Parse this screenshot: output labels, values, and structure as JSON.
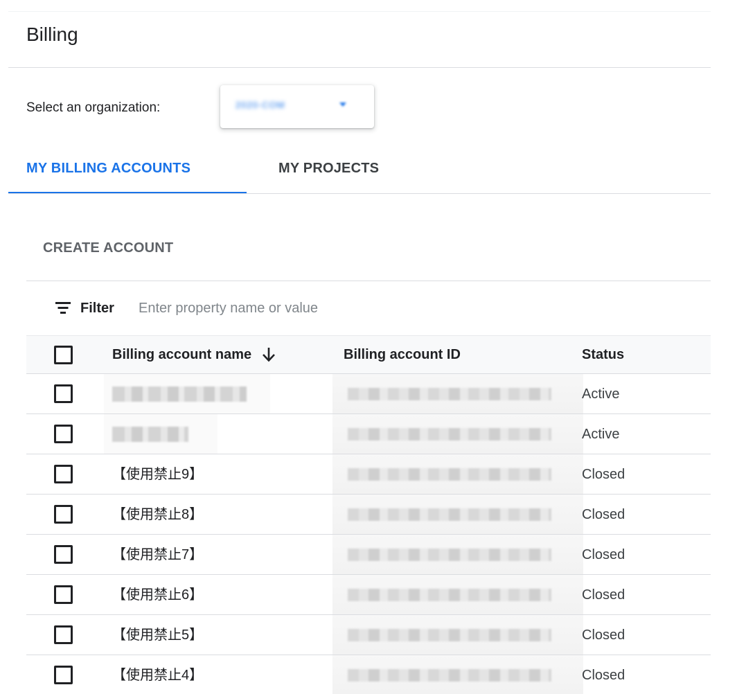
{
  "header": {
    "title": "Billing"
  },
  "organization": {
    "label": "Select an organization:",
    "selected_value": "2020-COM"
  },
  "tabs": [
    {
      "label": "MY BILLING ACCOUNTS",
      "active": true
    },
    {
      "label": "MY PROJECTS",
      "active": false
    }
  ],
  "toolbar": {
    "create_label": "CREATE ACCOUNT"
  },
  "filter": {
    "label": "Filter",
    "placeholder": "Enter property name or value"
  },
  "table": {
    "columns": {
      "name": "Billing account name",
      "id": "Billing account ID",
      "status": "Status"
    },
    "sort": {
      "column": "name",
      "direction": "descending"
    },
    "rows": [
      {
        "name": "",
        "name_redacted": true,
        "status": "Active"
      },
      {
        "name": "",
        "name_redacted": true,
        "status": "Active"
      },
      {
        "name": "【使用禁止9】",
        "name_redacted": false,
        "status": "Closed"
      },
      {
        "name": "【使用禁止8】",
        "name_redacted": false,
        "status": "Closed"
      },
      {
        "name": "【使用禁止7】",
        "name_redacted": false,
        "status": "Closed"
      },
      {
        "name": "【使用禁止6】",
        "name_redacted": false,
        "status": "Closed"
      },
      {
        "name": "【使用禁止5】",
        "name_redacted": false,
        "status": "Closed"
      },
      {
        "name": "【使用禁止4】",
        "name_redacted": false,
        "status": "Closed"
      }
    ]
  },
  "colors": {
    "accent": "#1a73e8",
    "text": "#202124",
    "muted": "#5f6368",
    "divider": "#dadce0"
  },
  "icons": {
    "filter": "filter-icon",
    "sort": "arrow-down-icon",
    "org_dropdown": "caret-down-icon"
  }
}
